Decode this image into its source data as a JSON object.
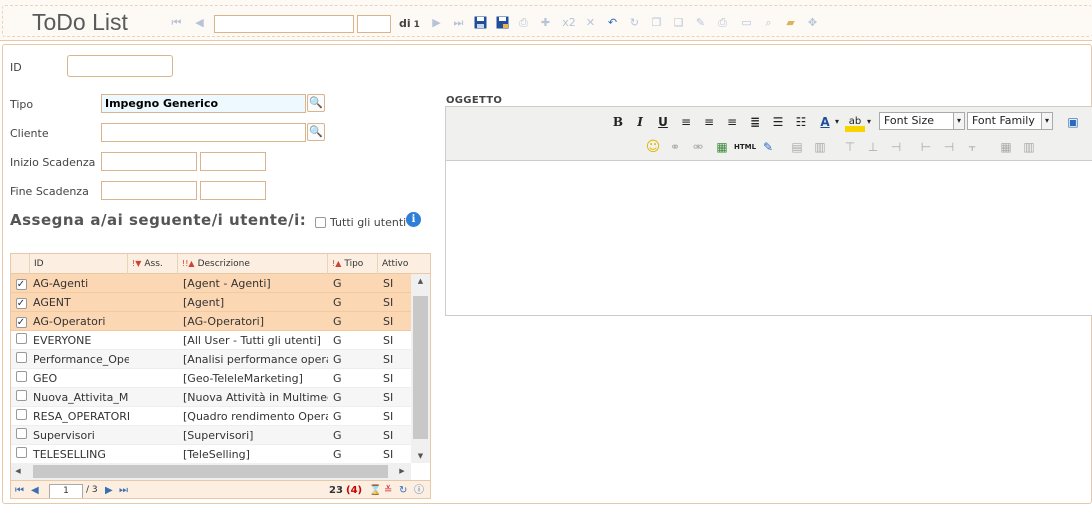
{
  "app": {
    "title": "ToDo List"
  },
  "toolbar": {
    "nav_input_value": "",
    "page_input_value": "",
    "of_label": "di",
    "total_pages": "1",
    "icons": [
      "first-icon",
      "prev-icon",
      "next-icon",
      "last-icon",
      "save-icon",
      "save-as-icon",
      "print-preview-icon",
      "new-icon",
      "copy-x2-icon",
      "delete-icon",
      "undo-icon",
      "refresh-icon",
      "copy-icon",
      "paste-icon",
      "edit-icon",
      "print-icon",
      "window-icon",
      "zoom-icon",
      "folder-icon",
      "move-icon"
    ]
  },
  "form": {
    "id": {
      "label": "ID",
      "value": ""
    },
    "tipo": {
      "label": "Tipo",
      "value": "Impegno Generico"
    },
    "cliente": {
      "label": "Cliente",
      "value": ""
    },
    "inizio": {
      "label": "Inizio Scadenza",
      "date": "",
      "time": ""
    },
    "fine": {
      "label": "Fine Scadenza",
      "date": "",
      "time": ""
    },
    "assign_title": "Assegna a/ai seguente/i utente/i:",
    "all_users_label": "Tutti gli utenti"
  },
  "grid": {
    "columns": [
      "ID",
      "Ass.",
      "Descrizione",
      "Tipo",
      "Attivo"
    ],
    "rows": [
      {
        "checked": true,
        "id": "AG-Agenti",
        "desc": "[Agent - Agenti]",
        "tipo": "G",
        "attivo": "SI"
      },
      {
        "checked": true,
        "id": "AGENT",
        "desc": "[Agent]",
        "tipo": "G",
        "attivo": "SI"
      },
      {
        "checked": true,
        "id": "AG-Operatori",
        "desc": "[AG-Operatori]",
        "tipo": "G",
        "attivo": "SI"
      },
      {
        "checked": false,
        "id": "EVERYONE",
        "desc": "[All User - Tutti gli utenti]",
        "tipo": "G",
        "attivo": "SI"
      },
      {
        "checked": false,
        "id": "Performance_Ope",
        "desc": "[Analisi performance operat",
        "tipo": "G",
        "attivo": "SI"
      },
      {
        "checked": false,
        "id": "GEO",
        "desc": "[Geo-TeleleMarketing]",
        "tipo": "G",
        "attivo": "SI"
      },
      {
        "checked": false,
        "id": "Nuova_Attivita_M",
        "desc": "[Nuova Attività in Multimed",
        "tipo": "G",
        "attivo": "SI"
      },
      {
        "checked": false,
        "id": "RESA_OPERATORI",
        "desc": "[Quadro rendimento Operat",
        "tipo": "G",
        "attivo": "SI"
      },
      {
        "checked": false,
        "id": "Supervisori",
        "desc": "[Supervisori]",
        "tipo": "G",
        "attivo": "SI"
      },
      {
        "checked": false,
        "id": "TELESELLING",
        "desc": "[TeleSelling]",
        "tipo": "G",
        "attivo": "SI"
      }
    ],
    "pager": {
      "page": "1",
      "of": "/ 3",
      "count": "23",
      "selected": "(4)"
    }
  },
  "editor": {
    "label": "OGGETTO",
    "font_size_label": "Font Size",
    "font_family_label": "Font Family",
    "content": ""
  },
  "colors": {
    "accent_border": "#d9b48c",
    "selected_row": "#fcd7b3",
    "header_bg": "#fcefe2",
    "link_blue": "#3a6fb0"
  }
}
